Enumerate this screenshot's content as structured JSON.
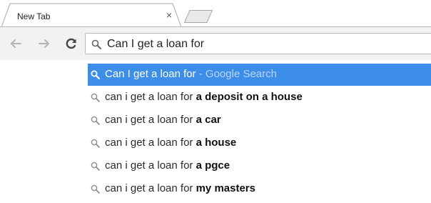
{
  "tab": {
    "title": "New Tab",
    "close_glyph": "×"
  },
  "toolbar": {
    "back_icon": "back-arrow-icon",
    "forward_icon": "forward-arrow-icon",
    "reload_icon": "reload-icon"
  },
  "omnibox": {
    "value": "Can I get a loan for",
    "icon": "search-icon"
  },
  "suggestions": [
    {
      "prefix": "Can I get a loan for",
      "bold": "",
      "hint": " - Google Search",
      "selected": true
    },
    {
      "prefix": "can i get a loan for ",
      "bold": "a deposit on a house",
      "hint": "",
      "selected": false
    },
    {
      "prefix": "can i get a loan for ",
      "bold": "a car",
      "hint": "",
      "selected": false
    },
    {
      "prefix": "can i get a loan for ",
      "bold": "a house",
      "hint": "",
      "selected": false
    },
    {
      "prefix": "can i get a loan for ",
      "bold": "a pgce",
      "hint": "",
      "selected": false
    },
    {
      "prefix": "can i get a loan for ",
      "bold": "my masters",
      "hint": "",
      "selected": false
    }
  ],
  "colors": {
    "selection": "#3d8ee8",
    "toolbar": "#f2f2f2",
    "hint": "#b9d6f7"
  }
}
